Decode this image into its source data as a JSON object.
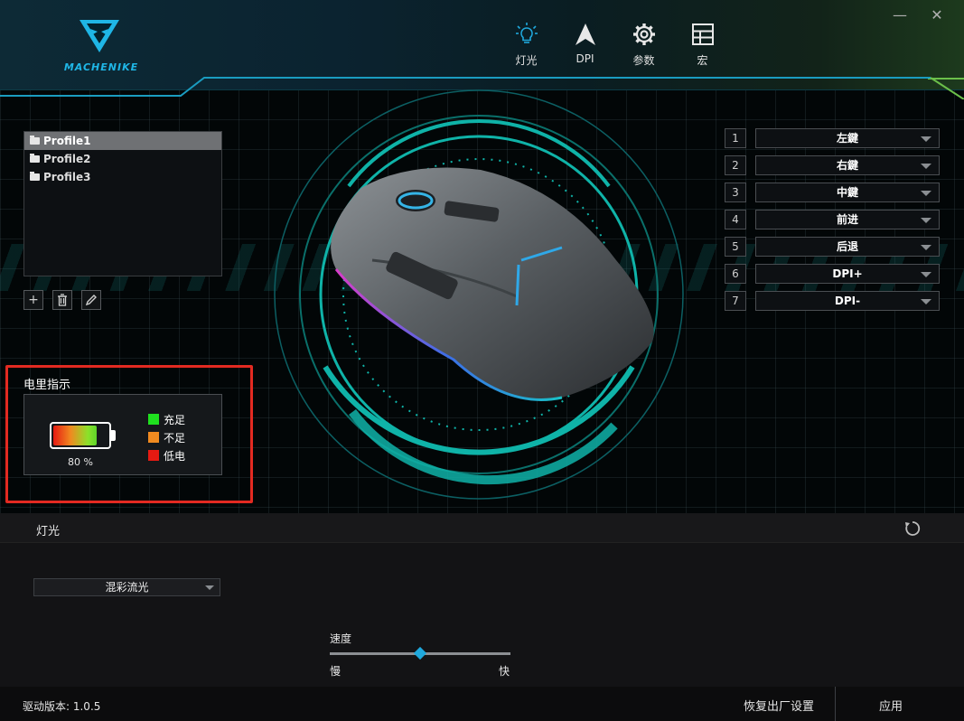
{
  "header": {
    "logo_text": "MACHENIKE",
    "nav": [
      {
        "label": "灯光",
        "icon": "lightbulb-icon"
      },
      {
        "label": "DPI",
        "icon": "arrow-up-icon"
      },
      {
        "label": "参数",
        "icon": "gear-icon"
      },
      {
        "label": "宏",
        "icon": "grid-icon"
      }
    ],
    "minimize": "—",
    "close": "✕"
  },
  "profiles": {
    "items": [
      "Profile1",
      "Profile2",
      "Profile3"
    ],
    "selected_index": 0,
    "tools": {
      "add": "+",
      "delete": "🗑",
      "edit": "✎"
    }
  },
  "battery": {
    "title": "电里指示",
    "percent_text": "80 %",
    "level": 0.8,
    "legend": [
      {
        "label": "充足",
        "color": "#1fe01f"
      },
      {
        "label": "不足",
        "color": "#f08a20"
      },
      {
        "label": "低电",
        "color": "#e61a12"
      }
    ]
  },
  "keymap": [
    {
      "num": "1",
      "label": "左鍵"
    },
    {
      "num": "2",
      "label": "右鍵"
    },
    {
      "num": "3",
      "label": "中鍵"
    },
    {
      "num": "4",
      "label": "前进"
    },
    {
      "num": "5",
      "label": "后退"
    },
    {
      "num": "6",
      "label": "DPI+"
    },
    {
      "num": "7",
      "label": "DPI-"
    }
  ],
  "lighting": {
    "title": "灯光",
    "effect": "混彩流光",
    "speed_label": "速度",
    "slow": "慢",
    "fast": "快",
    "speed_value": 0.5
  },
  "footer": {
    "version": "驱动版本: 1.0.5",
    "reset": "恢复出厂设置",
    "apply": "应用"
  },
  "colors": {
    "accent": "#1fa8dc",
    "ring": "#0fb3a8",
    "highlight_frame": "#e32a21"
  }
}
